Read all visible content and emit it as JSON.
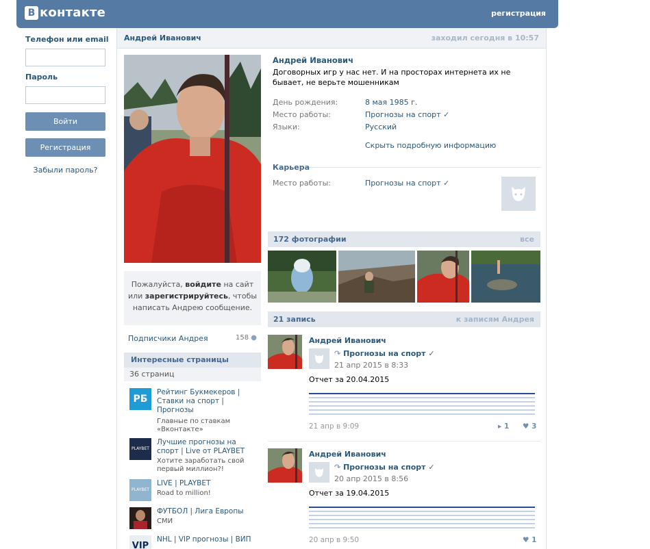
{
  "header": {
    "logo_letter": "B",
    "logo_text": "контакте",
    "register_link": "регистрация"
  },
  "login": {
    "phone_label": "Телефон или email",
    "password_label": "Пароль",
    "login_button": "Войти",
    "register_button": "Регистрация",
    "forgot_link": "Забыли пароль?"
  },
  "profile": {
    "name": "Андрей Иванович",
    "last_seen": "заходил сегодня в 10:57",
    "status": "Договорных игр у нас нет. И на просторах интернета их не бывает, не верьте мошенникам",
    "info": [
      {
        "label": "День рождения:",
        "value": "8 мая 1985 г."
      },
      {
        "label": "Место работы:",
        "value": "Прогнозы на спорт"
      },
      {
        "label": "Языки:",
        "value": "Русский"
      }
    ],
    "hide_info": "Скрыть подробную информацию",
    "career_header": "Карьера",
    "career": {
      "label": "Место работы:",
      "value": "Прогнозы на спорт"
    },
    "login_msg": {
      "p1": "Пожалуйста, ",
      "b1": "войдите",
      "p2": " на сайт или ",
      "b2": "зарегистрируйтесь",
      "p3": ", чтобы написать Андрею сообщение."
    },
    "subscribers_label": "Подписчики Андрея",
    "subscribers_count": "158",
    "interesting_header": "Интересные страницы",
    "interesting_count": "36 страниц",
    "interesting": [
      {
        "title": "Рейтинг Букмекеров | Ставки на спорт | Прогнозы",
        "sub": "Главные по ставкам «Вконтакте»",
        "icon_text": "РБ"
      },
      {
        "title": "Лучшие прогнозы на спорт | Live от PLAYBET",
        "sub": "Хотите заработать свой первый миллион?!",
        "icon_text": "PLAYBET"
      },
      {
        "title": "LIVE | PLAYBET",
        "sub": "Road to million!",
        "icon_text": "PLAYBET"
      },
      {
        "title": "ФУТБОЛ | Лига Европы",
        "sub": "СМИ",
        "icon_text": ""
      },
      {
        "title": "NHL | VIP прогнозы | ВИП",
        "sub": "",
        "icon_text": "VIP"
      }
    ],
    "photos_header": "172 фотографии",
    "photos_all": "все",
    "wall_header": "21 запись",
    "wall_link": "к записям Андрея",
    "posts": [
      {
        "author": "Андрей Иванович",
        "repost_name": "Прогнозы на спорт",
        "repost_date": "21 апр 2015 в 8:33",
        "text": "Отчет за 20.04.2015",
        "date": "21 апр в 9:09",
        "shares": "1",
        "likes": "3"
      },
      {
        "author": "Андрей Иванович",
        "repost_name": "Прогнозы на спорт",
        "repost_date": "20 апр 2015 в 8:56",
        "text": "Отчет за 19.04.2015",
        "date": "20 апр в 9:50",
        "shares": "",
        "likes": "1"
      }
    ]
  },
  "colors": {
    "header": "#557ba4",
    "link": "#2b587a",
    "bar": "#e1e7ed"
  }
}
